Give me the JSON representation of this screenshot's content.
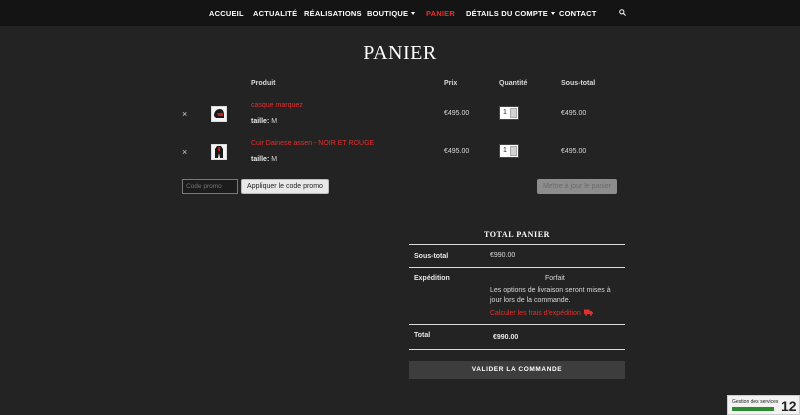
{
  "nav": {
    "items": [
      {
        "label": "ACCUEIL"
      },
      {
        "label": "ACTUALITÉ"
      },
      {
        "label": "RÉALISATIONS"
      },
      {
        "label": "BOUTIQUE"
      },
      {
        "label": "PANIER"
      },
      {
        "label": "DÉTAILS DU COMPTE"
      },
      {
        "label": "CONTACT"
      }
    ],
    "active": "PANIER",
    "search_icon": "search-icon"
  },
  "page": {
    "title": "PANIER"
  },
  "cart": {
    "headers": {
      "product": "Produit",
      "price": "Prix",
      "quantity": "Quantité",
      "subtotal": "Sous-total"
    },
    "rows": [
      {
        "remove": "×",
        "name": "casque marquez",
        "variation_label": "taille:",
        "variation_value": "M",
        "price": "€495.00",
        "quantity": "1",
        "subtotal": "€495.00"
      },
      {
        "remove": "×",
        "name": "Cuir Dainese assen - NOIR ET ROUGE",
        "variation_label": "taille:",
        "variation_value": "M",
        "price": "€495.00",
        "quantity": "1",
        "subtotal": "€495.00"
      }
    ],
    "coupon_placeholder": "Code promo",
    "apply_coupon": "Appliquer le code promo",
    "update_cart": "Mettre à jour le panier"
  },
  "totals": {
    "title": "TOTAL PANIER",
    "subtotal_label": "Sous-total",
    "subtotal_value": "€990.00",
    "shipping_label": "Expédition",
    "shipping_method": "Forfait",
    "shipping_note": "Les options de livraison seront mises à jour lors de la commande.",
    "shipping_calc": "Calculer les frais d'expédition",
    "total_label": "Total",
    "total_value": "€990.00",
    "checkout": "VALIDER LA COMMANDE"
  },
  "services_widget": {
    "label": "Gestion des services",
    "count": "12"
  },
  "colors": {
    "accent": "#e52d2d",
    "background": "#232323",
    "nav_background": "#141414"
  }
}
